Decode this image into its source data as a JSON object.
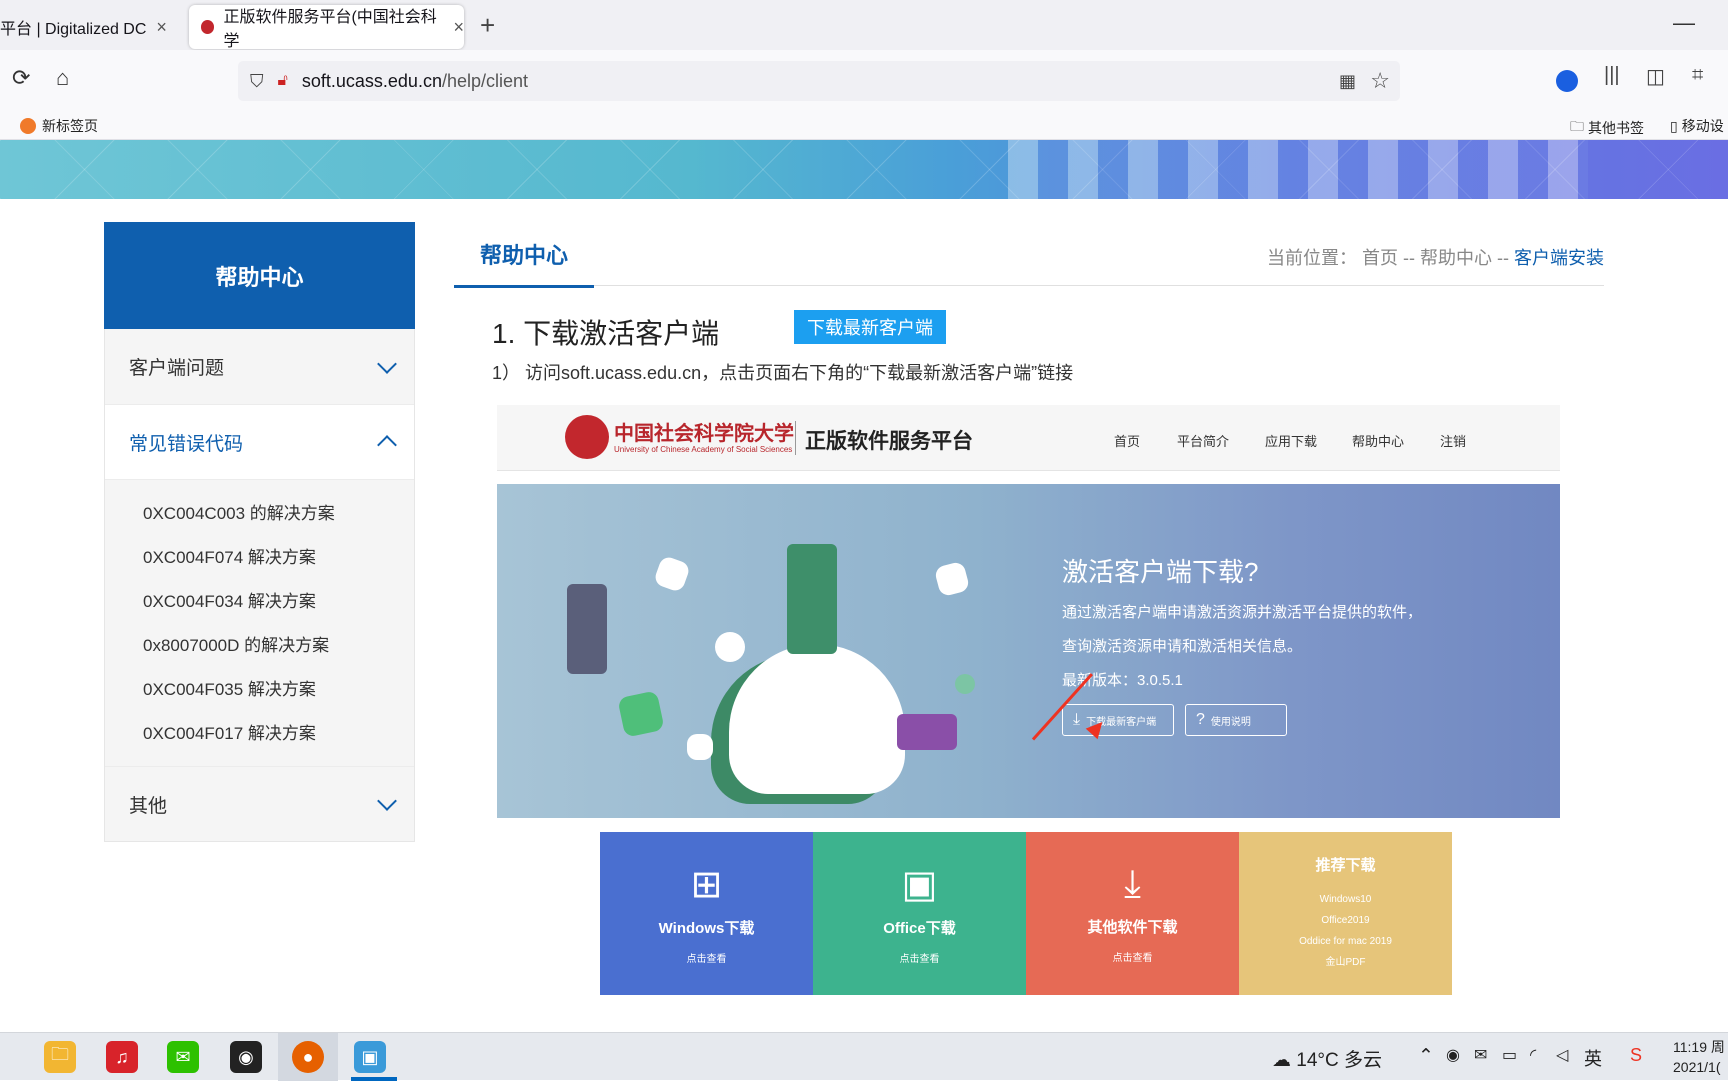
{
  "browser": {
    "tabs": [
      {
        "title": "平台 | Digitalized DC",
        "close": "×"
      },
      {
        "title": "正版软件服务平台(中国社会科学",
        "close": "×"
      }
    ],
    "new_tab": "+",
    "minimize": "—",
    "url_host": "soft.ucass.edu.cn",
    "url_path": "/help/client",
    "bookmarks": {
      "new_tab_page": "新标签页",
      "other_bookmarks": "其他书签",
      "mobile": "移动设"
    }
  },
  "sidebar": {
    "title": "帮助中心",
    "sections": [
      {
        "label": "客户端问题"
      },
      {
        "label": "常见错误代码"
      },
      {
        "label": "其他"
      }
    ],
    "error_items": [
      "0XC004C003 的解决方案",
      "0XC004F074 解决方案",
      "0XC004F034 解决方案",
      "0x8007000D 的解决方案",
      "0XC004F035 解决方案",
      "0XC004F017 解决方案"
    ]
  },
  "content": {
    "tab": "帮助中心",
    "breadcrumb": {
      "prefix": "当前位置：",
      "home": "首页",
      "sep": " -- ",
      "help": "帮助中心",
      "current": "客户端安装"
    },
    "step_title": "1. 下载激活客户端",
    "download_button": "下载最新客户端",
    "step_desc": "1）  访问soft.ucass.edu.cn，点击页面右下角的“下载最新激活客户端”链接"
  },
  "screenshot": {
    "logo_cn": "中国社会科学院大学",
    "logo_en": "University of Chinese Academy of Social Sciences",
    "platform": "正版软件服务平台",
    "nav": [
      "首页",
      "平台简介",
      "应用下载",
      "帮助中心",
      "注销"
    ],
    "hero_title": "激活客户端下载?",
    "hero_line1": "通过激活客户端申请激活资源并激活平台提供的软件，",
    "hero_line2": "查询激活资源申请和激活相关信息。",
    "version": "最新版本：3.0.5.1",
    "btn_download": "下载最新客户端",
    "btn_help": "使用说明",
    "tiles": [
      {
        "name": "Windows下载",
        "sub": "点击查看",
        "color": "#4a6fd0"
      },
      {
        "name": "Office下载",
        "sub": "点击查看",
        "color": "#3db38e"
      },
      {
        "name": "其他软件下载",
        "sub": "点击查看",
        "color": "#e66a55"
      }
    ],
    "recommend": {
      "title": "推荐下载",
      "items": [
        "Windows10",
        "Office2019",
        "Oddice for mac 2019",
        "金山PDF"
      ],
      "color": "#e6c57a"
    }
  },
  "taskbar": {
    "weather": "14°C  多云",
    "ime": "英",
    "time": "11:19 周",
    "date": "2021/1("
  }
}
